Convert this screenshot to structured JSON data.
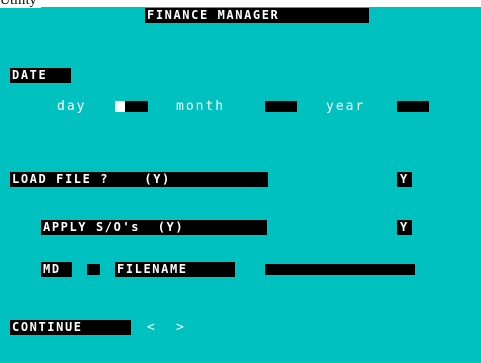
{
  "window_caption": "Utility",
  "title": "FINANCE MANAGER",
  "date": {
    "label": "DATE",
    "day_label": "day",
    "month_label": "month",
    "year_label": "year"
  },
  "load_file": {
    "prompt": "LOAD FILE ?    (Y)",
    "value": "Y"
  },
  "apply_so": {
    "prompt": "APPLY S/O's  (Y)",
    "value": "Y"
  },
  "md_label": "MD",
  "filename_label": "FILENAME",
  "continue": {
    "label": "CONTINUE",
    "prev": "<",
    "next": ">"
  },
  "colors": {
    "screen": "#00c0c0",
    "ink": "#000000",
    "paper": "#ffffff"
  }
}
